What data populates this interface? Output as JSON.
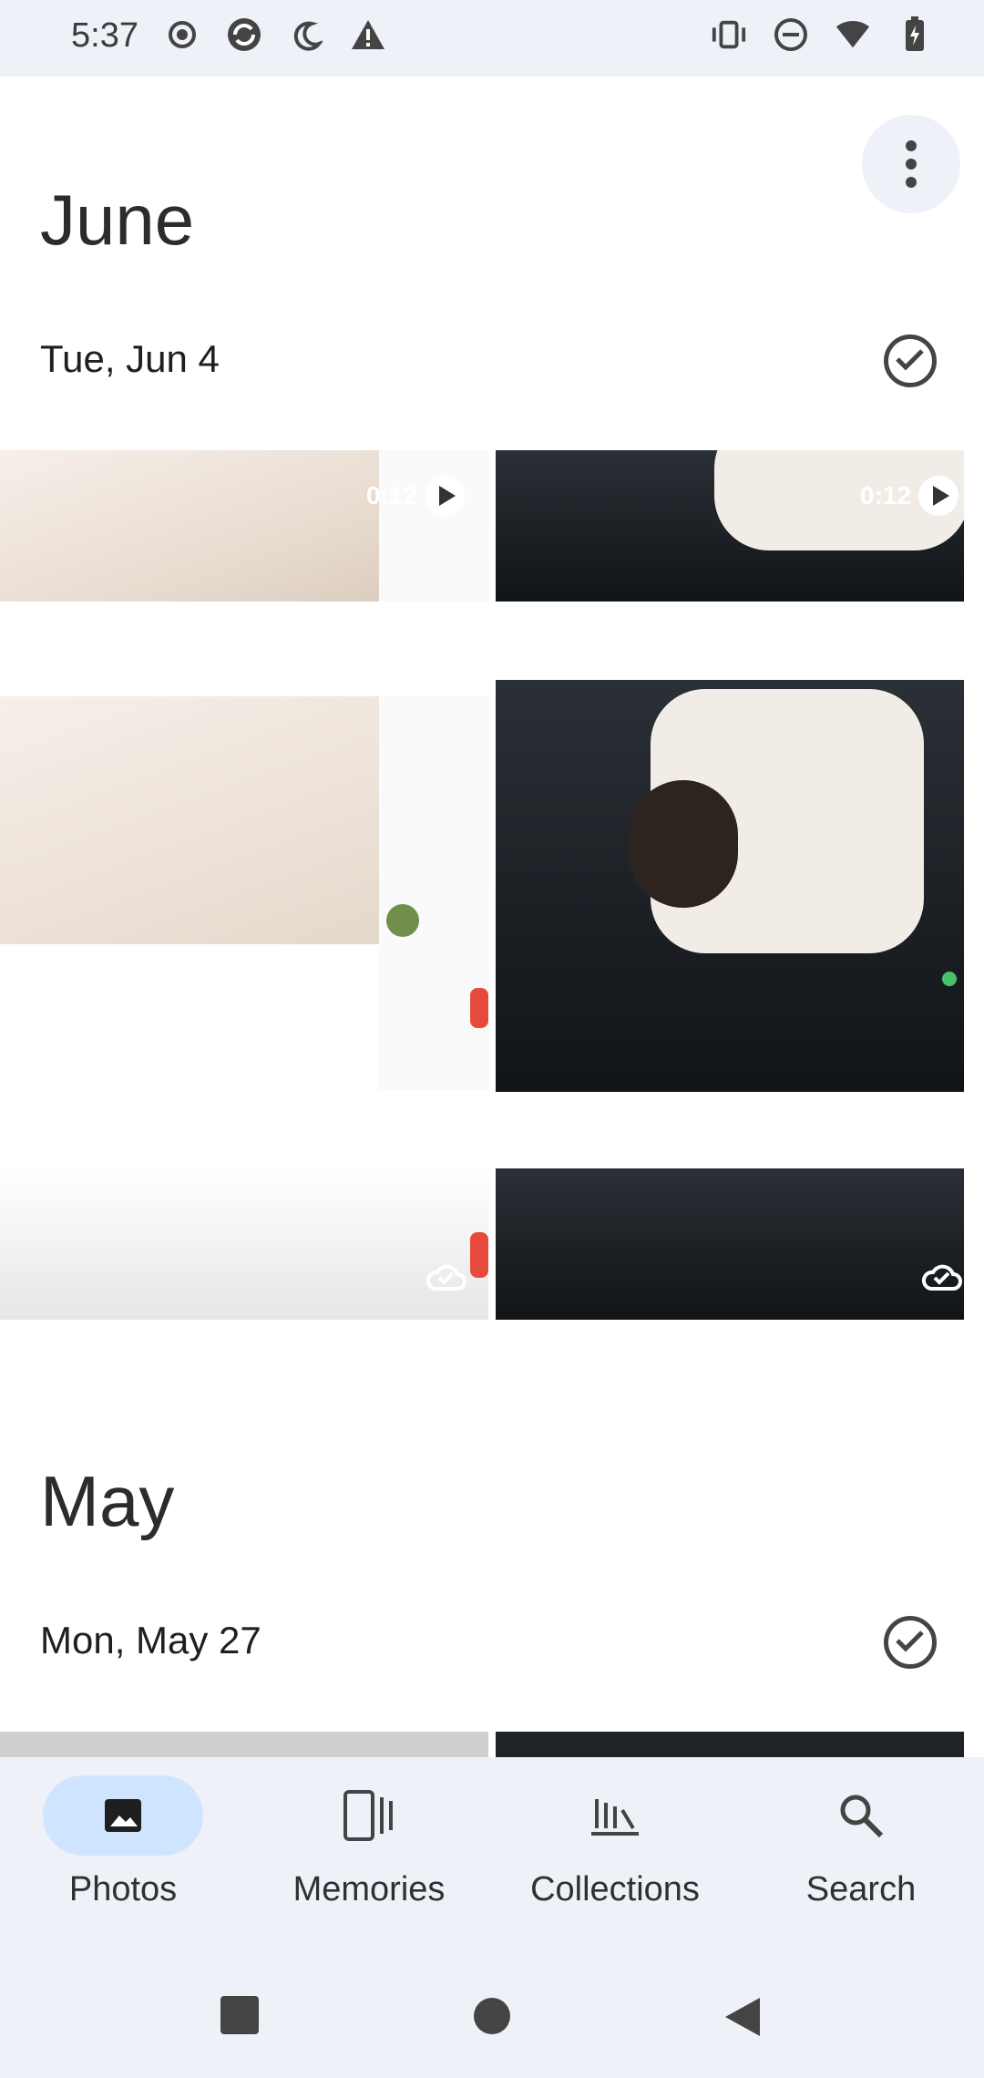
{
  "status_bar": {
    "time": "5:37",
    "left_icons": [
      "record-icon",
      "sync-icon",
      "night-mode-icon",
      "warning-icon"
    ],
    "right_icons": [
      "vibrate-icon",
      "dnd-icon",
      "wifi-icon",
      "battery-icon"
    ]
  },
  "header": {
    "more_label": "More options"
  },
  "sections": [
    {
      "month": "June",
      "date": "Tue, Jun 4"
    },
    {
      "month": "May",
      "date": "Mon, May 27"
    }
  ],
  "tiles": [
    {
      "overlay_time": "0:12"
    },
    {
      "overlay_time": "0:12"
    }
  ],
  "bottom_nav": {
    "items": [
      {
        "label": "Photos",
        "icon": "photo-icon",
        "active": true
      },
      {
        "label": "Memories",
        "icon": "memories-icon",
        "active": false
      },
      {
        "label": "Collections",
        "icon": "collections-icon",
        "active": false
      },
      {
        "label": "Search",
        "icon": "search-icon",
        "active": false
      }
    ]
  },
  "colors": {
    "accent": "#cfe5ff",
    "surface": "#eef1f7"
  }
}
